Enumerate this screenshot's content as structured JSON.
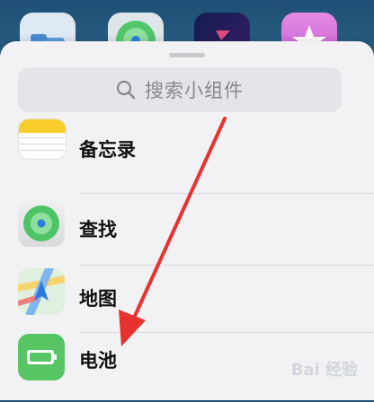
{
  "search": {
    "placeholder": "搜索小组件"
  },
  "widgets": [
    {
      "name": "备忘录",
      "icon": "notes-icon"
    },
    {
      "name": "查找",
      "icon": "find-my-icon"
    },
    {
      "name": "地图",
      "icon": "maps-icon"
    },
    {
      "name": "电池",
      "icon": "battery-icon"
    }
  ],
  "background_apps": [
    "files-icon",
    "find-my-icon",
    "shortcuts-icon",
    "starred-icon"
  ],
  "watermark": {
    "text": "Bai 经验"
  },
  "colors": {
    "arrow": "#e8322f",
    "battery": "#58c565",
    "notes": "#f8cd2b",
    "sheet": "#f2f2f4"
  }
}
